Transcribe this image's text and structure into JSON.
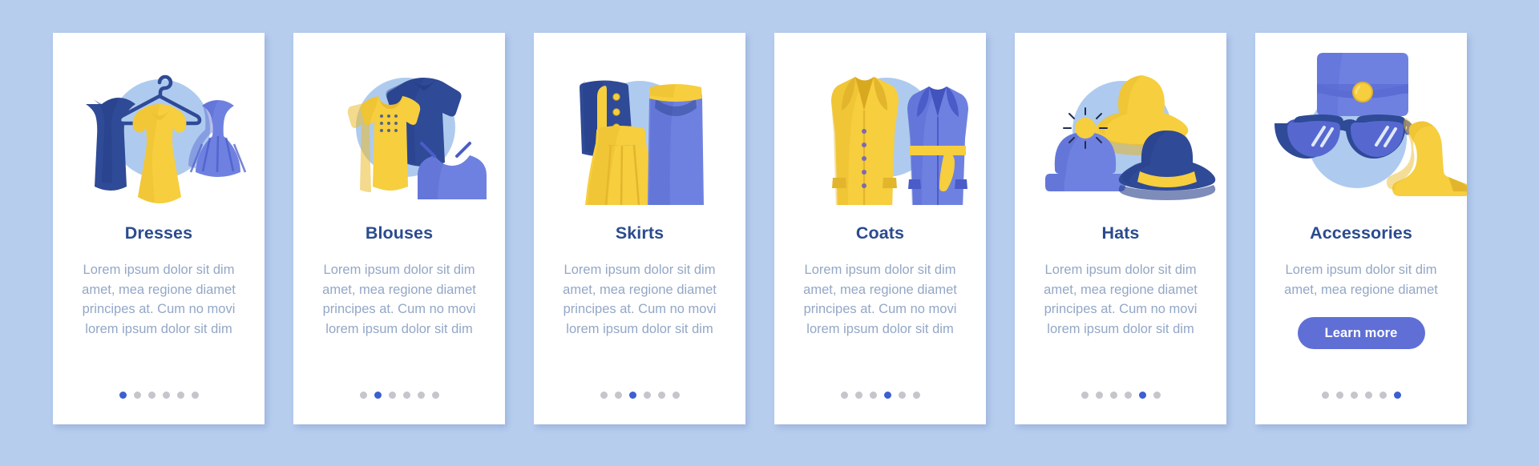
{
  "page": {
    "background_color": "#b6cdee",
    "card_background": "#ffffff",
    "title_color": "#2b4b8e",
    "body_color": "#93a7c6",
    "accent_color": "#3c5fd2",
    "button_color": "#5f6fd6",
    "dot_inactive_color": "#c4c6cb",
    "body_text": "Lorem ipsum dolor sit dim amet, mea regione diamet principes at. Cum no movi lorem ipsum dolor sit dim",
    "short_body_text": "Lorem ipsum dolor sit dim amet, mea regione diamet"
  },
  "cards": [
    {
      "id": "dresses",
      "title": "Dresses",
      "description": "Lorem ipsum dolor sit dim amet, mea regione diamet principes at. Cum no movi lorem ipsum dolor sit dim",
      "illustration": "dresses-illustration",
      "dots_total": 6,
      "dot_active_index": 0,
      "has_button": false,
      "button_label": ""
    },
    {
      "id": "blouses",
      "title": "Blouses",
      "description": "Lorem ipsum dolor sit dim amet, mea regione diamet principes at. Cum no movi lorem ipsum dolor sit dim",
      "illustration": "blouses-illustration",
      "dots_total": 6,
      "dot_active_index": 1,
      "has_button": false,
      "button_label": ""
    },
    {
      "id": "skirts",
      "title": "Skirts",
      "description": "Lorem ipsum dolor sit dim amet, mea regione diamet principes at. Cum no movi lorem ipsum dolor sit dim",
      "illustration": "skirts-illustration",
      "dots_total": 6,
      "dot_active_index": 2,
      "has_button": false,
      "button_label": ""
    },
    {
      "id": "coats",
      "title": "Coats",
      "description": "Lorem ipsum dolor sit dim amet, mea regione diamet principes at. Cum no movi lorem ipsum dolor sit dim",
      "illustration": "coats-illustration",
      "dots_total": 6,
      "dot_active_index": 3,
      "has_button": false,
      "button_label": ""
    },
    {
      "id": "hats",
      "title": "Hats",
      "description": "Lorem ipsum dolor sit dim amet, mea regione diamet principes at. Cum no movi lorem ipsum dolor sit dim",
      "illustration": "hats-illustration",
      "dots_total": 6,
      "dot_active_index": 4,
      "has_button": false,
      "button_label": ""
    },
    {
      "id": "accessories",
      "title": "Accessories",
      "description": "Lorem ipsum dolor sit dim amet, mea regione diamet",
      "illustration": "accessories-illustration",
      "dots_total": 6,
      "dot_active_index": 5,
      "has_button": true,
      "button_label": "Learn more"
    }
  ]
}
